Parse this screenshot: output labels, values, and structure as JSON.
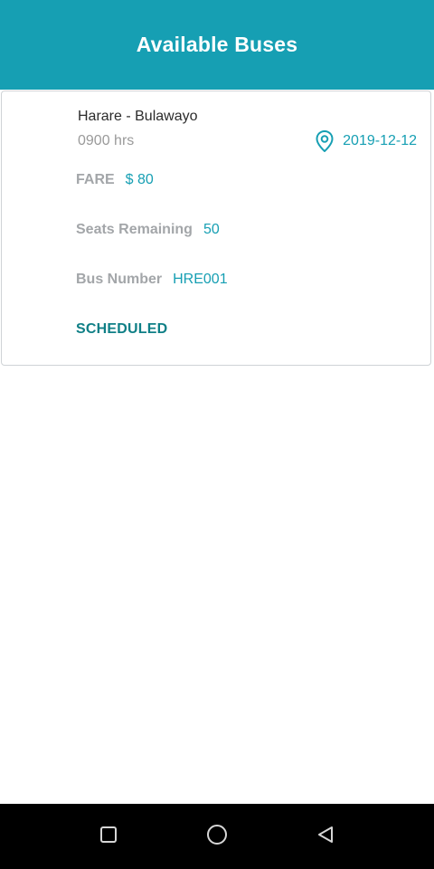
{
  "header": {
    "title": "Available Buses"
  },
  "bus": {
    "route": "Harare - Bulawayo",
    "time": "0900 hrs",
    "date": "2019-12-12",
    "fare_label": "FARE",
    "fare_value": "$ 80",
    "seats_label": "Seats Remaining",
    "seats_value": "50",
    "bus_number_label": "Bus Number",
    "bus_number_value": "HRE001",
    "status": "SCHEDULED"
  },
  "icons": {
    "location": "location-pin-icon",
    "recents": "square-icon",
    "home": "circle-icon",
    "back": "triangle-back-icon"
  },
  "colors": {
    "accent": "#169fb3",
    "status": "#0f7f86",
    "label_gray": "#a3a6a9"
  }
}
